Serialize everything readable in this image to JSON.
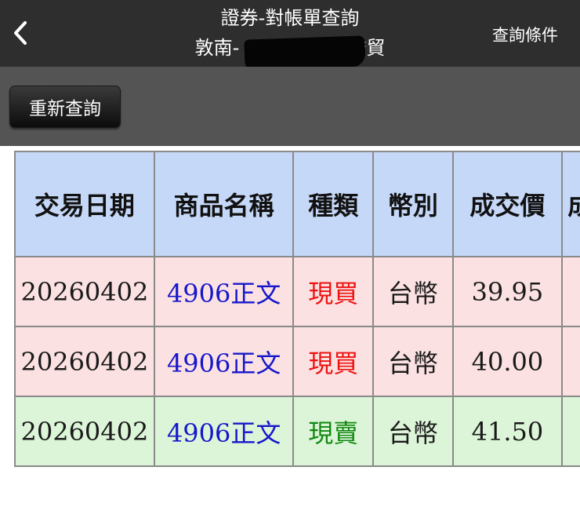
{
  "navbar": {
    "back_icon": "chevron-left-icon",
    "title": "證券-對帳單查詢",
    "subtitle_prefix": "敦南-",
    "subtitle_suffix": "*貿",
    "query_conditions_label": "查詢條件"
  },
  "toolbar": {
    "requery_label": "重新查詢"
  },
  "table": {
    "headers": [
      "交易日期",
      "商品名稱",
      "種類",
      "幣別",
      "成交價",
      "成"
    ],
    "rows": [
      {
        "date": "20260402",
        "product": "4906正文",
        "type": "現買",
        "currency": "台幣",
        "price": "39.95"
      },
      {
        "date": "20260402",
        "product": "4906正文",
        "type": "現買",
        "currency": "台幣",
        "price": "40.00"
      },
      {
        "date": "20260402",
        "product": "4906正文",
        "type": "現賣",
        "currency": "台幣",
        "price": "41.50"
      }
    ]
  },
  "colors": {
    "navbar_bg": "#2e2e2e",
    "toolbar_bg": "#545454",
    "header_bg": "#c6d8f7",
    "buy_row_bg": "#fbe1e1",
    "sell_row_bg": "#dcf5d8",
    "product_text": "#1616cc",
    "buy_text": "#ee1111",
    "sell_text": "#118811"
  }
}
